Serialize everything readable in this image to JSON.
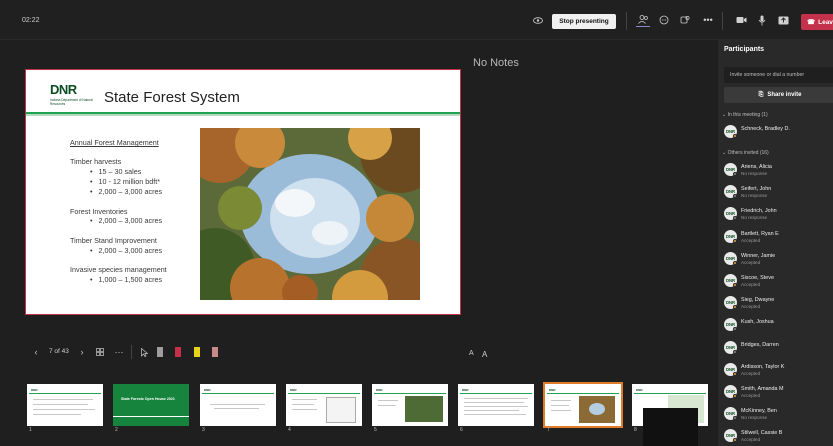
{
  "topbar": {
    "time": "02:22",
    "stop_presenting": "Stop presenting",
    "leave": "Leav",
    "icons": [
      "eye-icon",
      "participants-icon",
      "chat-icon",
      "reactions-icon",
      "more-icon",
      "camera-icon",
      "mic-icon",
      "share-screen-icon",
      "phone-icon"
    ]
  },
  "notes": {
    "label": "No Notes"
  },
  "slide": {
    "logo": "DNR",
    "logo_sub": "Indiana Department of Natural Resources",
    "title": "State Forest System",
    "heading": "Annual Forest Management",
    "sections": [
      {
        "title": "Timber harvests",
        "bullets": [
          "15 – 30 sales",
          "10 - 12 million bdft*",
          "2,000 – 3,000 acres"
        ]
      },
      {
        "title": "Forest Inventories",
        "bullets": [
          "2,000 – 3,000 acres"
        ]
      },
      {
        "title": "Timber Stand Improvement",
        "bullets": [
          "2,000 – 3,000 acres"
        ]
      },
      {
        "title": "Invasive species management",
        "bullets": [
          "1,000 – 1,500 acres"
        ]
      }
    ]
  },
  "controls": {
    "counter": "7 of 43",
    "font_decrease": "A",
    "font_increase": "A"
  },
  "participants": {
    "title": "Participants",
    "invite_placeholder": "Invite someone or dial a number",
    "share_invite": "Share invite",
    "in_meeting_label": "In this meeting (1)",
    "others_label": "Others invited (16)",
    "in_meeting": [
      {
        "name": "Schneck, Bradley D.",
        "status": ""
      }
    ],
    "others": [
      {
        "name": "Ariens, Alicia",
        "status": "No response"
      },
      {
        "name": "Seifert, John",
        "status": "No response"
      },
      {
        "name": "Friedrich, John",
        "status": "No response"
      },
      {
        "name": "Bartlett, Ryan E",
        "status": "Accepted"
      },
      {
        "name": "Winner, Jamie",
        "status": "Accepted"
      },
      {
        "name": "Siscoe, Steve",
        "status": "Accepted"
      },
      {
        "name": "Sieg, Dwayne",
        "status": "Accepted"
      },
      {
        "name": "Kush, Joshua",
        "status": ""
      },
      {
        "name": "Bridges, Darren",
        "status": ""
      },
      {
        "name": "Ardisson, Taylor K",
        "status": "Accepted"
      },
      {
        "name": "Smith, Amanda M",
        "status": "Accepted"
      },
      {
        "name": "McKinney, Ben",
        "status": "No response"
      },
      {
        "name": "Stilwell, Cassie B",
        "status": "Accepted"
      }
    ],
    "avatar_text": "DNR"
  },
  "thumbnails": {
    "numbers": [
      "1",
      "2",
      "3",
      "4",
      "5",
      "6",
      "7",
      "8"
    ],
    "slide2_title": "State Forests Open House 2021",
    "selected": "7"
  },
  "colors": {
    "accent": "#c4314b",
    "brand_green": "#0b4d22",
    "selected_thumb": "#e07b2a"
  }
}
